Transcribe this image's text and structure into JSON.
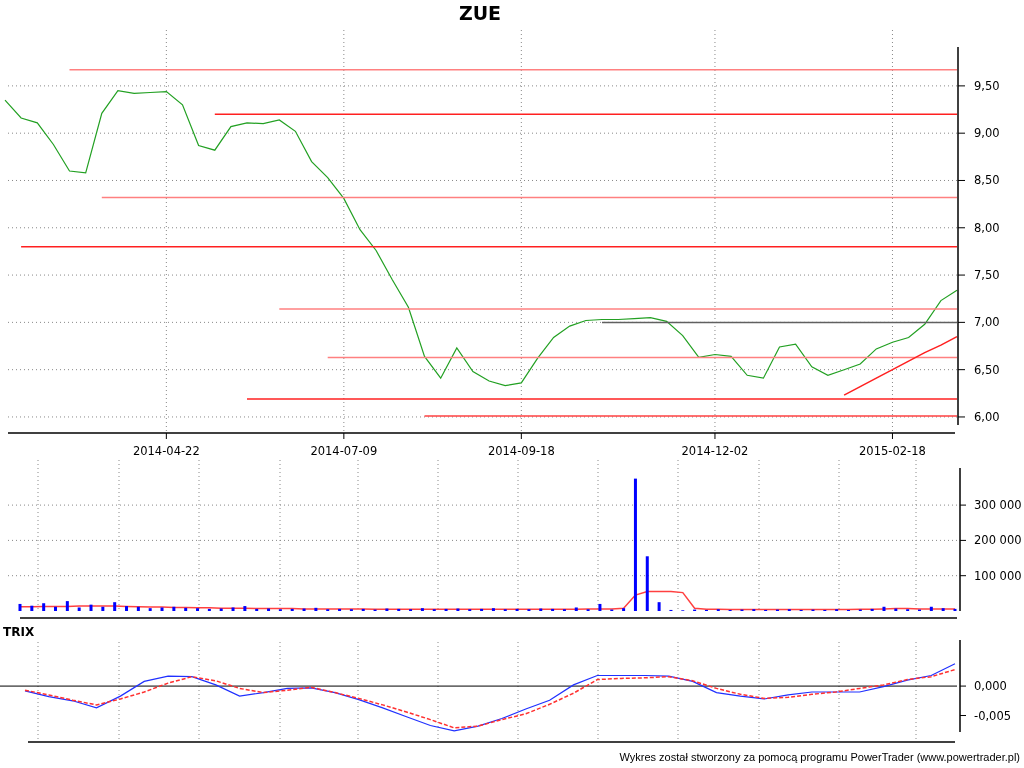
{
  "title": "ZUE",
  "price_panel": {
    "chart_data": {
      "type": "line",
      "grid": true,
      "ylim": [
        5.915,
        9.911
      ],
      "categories": [
        null,
        null,
        null,
        null,
        null,
        null,
        null,
        null,
        null,
        null,
        "2014-04-22",
        null,
        null,
        null,
        null,
        null,
        null,
        null,
        null,
        null,
        null,
        "2014-07-09",
        null,
        null,
        null,
        null,
        null,
        null,
        null,
        null,
        null,
        null,
        "2014-09-18",
        null,
        null,
        null,
        null,
        null,
        null,
        null,
        null,
        null,
        null,
        null,
        "2014-12-02",
        null,
        null,
        null,
        null,
        null,
        null,
        null,
        null,
        null,
        null,
        "2015-02-18",
        null,
        null,
        null,
        null
      ],
      "yticks": [
        {
          "value": 6,
          "label": "6,00"
        },
        {
          "value": 6.5,
          "label": "6,50"
        },
        {
          "value": 7,
          "label": "7,00"
        },
        {
          "value": 7.5,
          "label": "7,50"
        },
        {
          "value": 8,
          "label": "8,00"
        },
        {
          "value": 8.5,
          "label": "8,50"
        },
        {
          "value": 9,
          "label": "9,00"
        },
        {
          "value": 9.5,
          "label": "9,50"
        }
      ],
      "series": [
        {
          "color": "#22a022",
          "values": [
            9.35,
            9.16,
            9.11,
            8.88,
            8.6,
            8.58,
            9.21,
            9.45,
            9.42,
            9.43,
            9.44,
            9.3,
            8.87,
            8.82,
            9.07,
            9.11,
            9.1,
            9.14,
            9.02,
            8.7,
            8.53,
            8.31,
            7.98,
            7.76,
            7.45,
            7.16,
            6.64,
            6.41,
            6.73,
            6.48,
            6.38,
            6.33,
            6.36,
            6.62,
            6.84,
            6.96,
            7.02,
            7.03,
            7.03,
            7.04,
            7.05,
            7.01,
            6.86,
            6.63,
            6.66,
            6.64,
            6.44,
            6.41,
            6.74,
            6.77,
            6.53,
            6.44,
            6.5,
            6.56,
            6.72,
            6.79,
            6.84,
            6.98,
            7.23,
            7.34
          ]
        },
        {
          "color": "#ff8080",
          "values": [
            null,
            null,
            null,
            null,
            9.67,
            9.67,
            9.67,
            9.67,
            9.67,
            9.67,
            9.67,
            9.67,
            9.67,
            9.67,
            9.67,
            9.67,
            9.67,
            9.67,
            9.67,
            9.67,
            9.67,
            9.67,
            9.67,
            9.67,
            9.67,
            9.67,
            9.67,
            9.67,
            9.67,
            9.67,
            9.67,
            9.67,
            9.67,
            9.67,
            9.67,
            9.67,
            9.67,
            9.67,
            9.67,
            9.67,
            9.67,
            9.67,
            9.67,
            9.67,
            9.67,
            9.67,
            9.67,
            9.67,
            9.67,
            9.67,
            9.67,
            9.67,
            9.67,
            9.67,
            9.67,
            9.67,
            9.67,
            9.67,
            9.67,
            9.67
          ]
        },
        {
          "color": "#ff2020",
          "values": [
            null,
            null,
            null,
            null,
            null,
            null,
            null,
            null,
            null,
            null,
            null,
            null,
            null,
            9.2,
            9.2,
            9.2,
            9.2,
            9.2,
            9.2,
            9.2,
            9.2,
            9.2,
            9.2,
            9.2,
            9.2,
            9.2,
            9.2,
            9.2,
            9.2,
            9.2,
            9.2,
            9.2,
            9.2,
            9.2,
            9.2,
            9.2,
            9.2,
            9.2,
            9.2,
            9.2,
            9.2,
            9.2,
            9.2,
            9.2,
            9.2,
            9.2,
            9.2,
            9.2,
            9.2,
            9.2,
            9.2,
            9.2,
            9.2,
            9.2,
            9.2,
            9.2,
            9.2,
            9.2,
            9.2,
            9.2
          ]
        },
        {
          "color": "#ff8080",
          "values": [
            null,
            null,
            null,
            null,
            null,
            null,
            8.32,
            8.32,
            8.32,
            8.32,
            8.32,
            8.32,
            8.32,
            8.32,
            8.32,
            8.32,
            8.32,
            8.32,
            8.32,
            8.32,
            8.32,
            8.32,
            8.32,
            8.32,
            8.32,
            8.32,
            8.32,
            8.32,
            8.32,
            8.32,
            8.32,
            8.32,
            8.32,
            8.32,
            8.32,
            8.32,
            8.32,
            8.32,
            8.32,
            8.32,
            8.32,
            8.32,
            8.32,
            8.32,
            8.32,
            8.32,
            8.32,
            8.32,
            8.32,
            8.32,
            8.32,
            8.32,
            8.32,
            8.32,
            8.32,
            8.32,
            8.32,
            8.32,
            8.32,
            8.32
          ]
        },
        {
          "color": "#ff2020",
          "values": [
            null,
            7.8,
            7.8,
            7.8,
            7.8,
            7.8,
            7.8,
            7.8,
            7.8,
            7.8,
            7.8,
            7.8,
            7.8,
            7.8,
            7.8,
            7.8,
            7.8,
            7.8,
            7.8,
            7.8,
            7.8,
            7.8,
            7.8,
            7.8,
            7.8,
            7.8,
            7.8,
            7.8,
            7.8,
            7.8,
            7.8,
            7.8,
            7.8,
            7.8,
            7.8,
            7.8,
            7.8,
            7.8,
            7.8,
            7.8,
            7.8,
            7.8,
            7.8,
            7.8,
            7.8,
            7.8,
            7.8,
            7.8,
            7.8,
            7.8,
            7.8,
            7.8,
            7.8,
            7.8,
            7.8,
            7.8,
            7.8,
            7.8,
            7.8,
            7.8
          ]
        },
        {
          "color": "#ff8080",
          "values": [
            null,
            null,
            null,
            null,
            null,
            null,
            null,
            null,
            null,
            null,
            null,
            null,
            null,
            null,
            null,
            null,
            null,
            7.14,
            7.14,
            7.14,
            7.14,
            7.14,
            7.14,
            7.14,
            7.14,
            7.14,
            7.14,
            7.14,
            7.14,
            7.14,
            7.14,
            7.14,
            7.14,
            7.14,
            7.14,
            7.14,
            7.14,
            7.14,
            7.14,
            7.14,
            7.14,
            7.14,
            7.14,
            7.14,
            7.14,
            7.14,
            7.14,
            7.14,
            7.14,
            7.14,
            7.14,
            7.14,
            7.14,
            7.14,
            7.14,
            7.14,
            7.14,
            7.14,
            7.14,
            7.14
          ]
        },
        {
          "color": "#606060",
          "values": [
            null,
            null,
            null,
            null,
            null,
            null,
            null,
            null,
            null,
            null,
            null,
            null,
            null,
            null,
            null,
            null,
            null,
            null,
            null,
            null,
            null,
            null,
            null,
            null,
            null,
            null,
            null,
            null,
            null,
            null,
            null,
            null,
            null,
            null,
            null,
            null,
            null,
            7.0,
            7.0,
            7.0,
            7.0,
            7.0,
            7.0,
            7.0,
            7.0,
            7.0,
            7.0,
            7.0,
            7.0,
            7.0,
            7.0,
            7.0,
            7.0,
            7.0,
            7.0,
            7.0,
            7.0,
            7.0,
            7.0,
            7.0
          ]
        },
        {
          "color": "#ff8080",
          "values": [
            null,
            null,
            null,
            null,
            null,
            null,
            null,
            null,
            null,
            null,
            null,
            null,
            null,
            null,
            null,
            null,
            null,
            null,
            null,
            null,
            6.63,
            6.63,
            6.63,
            6.63,
            6.63,
            6.63,
            6.63,
            6.63,
            6.63,
            6.63,
            6.63,
            6.63,
            6.63,
            6.63,
            6.63,
            6.63,
            6.63,
            6.63,
            6.63,
            6.63,
            6.63,
            6.63,
            6.63,
            6.63,
            6.63,
            6.63,
            6.63,
            6.63,
            6.63,
            6.63,
            6.63,
            6.63,
            6.63,
            6.63,
            6.63,
            6.63,
            6.63,
            6.63,
            6.63,
            6.63
          ]
        },
        {
          "color": "#ff2020",
          "values": [
            null,
            null,
            null,
            null,
            null,
            null,
            null,
            null,
            null,
            null,
            null,
            null,
            null,
            null,
            null,
            6.19,
            6.19,
            6.19,
            6.19,
            6.19,
            6.19,
            6.19,
            6.19,
            6.19,
            6.19,
            6.19,
            6.19,
            6.19,
            6.19,
            6.19,
            6.19,
            6.19,
            6.19,
            6.19,
            6.19,
            6.19,
            6.19,
            6.19,
            6.19,
            6.19,
            6.19,
            6.19,
            6.19,
            6.19,
            6.19,
            6.19,
            6.19,
            6.19,
            6.19,
            6.19,
            6.19,
            6.19,
            6.19,
            6.19,
            6.19,
            6.19,
            6.19,
            6.19,
            6.19,
            6.19
          ]
        },
        {
          "color": "#ff4040",
          "values": [
            null,
            null,
            null,
            null,
            null,
            null,
            null,
            null,
            null,
            null,
            null,
            null,
            null,
            null,
            null,
            null,
            null,
            null,
            null,
            null,
            null,
            null,
            null,
            null,
            null,
            null,
            6.01,
            6.01,
            6.01,
            6.01,
            6.01,
            6.01,
            6.01,
            6.01,
            6.01,
            6.01,
            6.01,
            6.01,
            6.01,
            6.01,
            6.01,
            6.01,
            6.01,
            6.01,
            6.01,
            6.01,
            6.01,
            6.01,
            6.01,
            6.01,
            6.01,
            6.01,
            6.01,
            6.01,
            6.01,
            6.01,
            6.01,
            6.01,
            6.01,
            6.01
          ]
        },
        {
          "color": "#ff2020",
          "values": [
            null,
            null,
            null,
            null,
            null,
            null,
            null,
            null,
            null,
            null,
            null,
            null,
            null,
            null,
            null,
            null,
            null,
            null,
            null,
            null,
            null,
            null,
            null,
            null,
            null,
            null,
            null,
            null,
            null,
            null,
            null,
            null,
            null,
            null,
            null,
            null,
            null,
            null,
            null,
            null,
            null,
            null,
            null,
            null,
            null,
            null,
            null,
            null,
            null,
            null,
            null,
            null,
            6.23,
            6.32,
            6.41,
            6.5,
            6.59,
            6.68,
            6.76,
            6.85
          ]
        }
      ]
    }
  },
  "volume_panel": {
    "chart_data": {
      "type": "bar",
      "grid": true,
      "ylim": [
        0,
        405100
      ],
      "categories": [
        null,
        null,
        null,
        null,
        null,
        null,
        null,
        null,
        null,
        null,
        null,
        null,
        null,
        null,
        null,
        null,
        null,
        null,
        null,
        null,
        null,
        null,
        null,
        null,
        null,
        null,
        null,
        null,
        null,
        null,
        null,
        null,
        null,
        null,
        null,
        null,
        null,
        null,
        null,
        null,
        null,
        null,
        null,
        null,
        null,
        null,
        null,
        null,
        null,
        null,
        null,
        null,
        null,
        null,
        null,
        null,
        null,
        null,
        null,
        null,
        null,
        null,
        null,
        null,
        null,
        null,
        null,
        null,
        null,
        null,
        null,
        null,
        null,
        null,
        null,
        null,
        null,
        null,
        null,
        null
      ],
      "yticks": [
        {
          "value": 100000,
          "label": "100 000"
        },
        {
          "value": 200000,
          "label": "200 000"
        },
        {
          "value": 300000,
          "label": "300 000"
        }
      ],
      "series": [
        {
          "color": "#0000ff",
          "values": [
            20000,
            15000,
            22000,
            12000,
            28000,
            10000,
            18000,
            12000,
            25000,
            14000,
            12000,
            8000,
            10000,
            12000,
            9000,
            8000,
            6000,
            7000,
            10000,
            14000,
            6000,
            7000,
            5000,
            6000,
            7000,
            9000,
            5000,
            6000,
            5000,
            6000,
            4000,
            7000,
            6000,
            5000,
            8000,
            5000,
            6000,
            7000,
            5000,
            6000,
            8000,
            5000,
            6000,
            5000,
            7000,
            6000,
            5000,
            10000,
            5000,
            20000,
            4000,
            8000,
            375000,
            155000,
            25000,
            3000,
            2000,
            4000,
            3000,
            5000,
            3000,
            4000,
            5000,
            3000,
            4000,
            5000,
            3000,
            4000,
            3000,
            5000,
            3000,
            4000,
            6000,
            12000,
            7000,
            5000,
            4000,
            12000,
            8000,
            6000
          ]
        },
        {
          "type": "line",
          "color": "#ff4040",
          "values": [
            12000,
            12000,
            13000,
            13000,
            13000,
            14000,
            14000,
            14000,
            14000,
            13000,
            12000,
            11000,
            11000,
            10000,
            10000,
            9000,
            9000,
            8000,
            8000,
            8000,
            7000,
            7000,
            7000,
            7000,
            6000,
            6000,
            6000,
            6000,
            6000,
            6000,
            5000,
            5000,
            5000,
            5000,
            5000,
            5000,
            5000,
            5000,
            5000,
            5000,
            5000,
            5000,
            5000,
            5000,
            5000,
            5000,
            5000,
            5000,
            6000,
            6000,
            6000,
            8000,
            45000,
            55000,
            55000,
            55000,
            52000,
            8000,
            5000,
            5000,
            4000,
            4000,
            4000,
            4000,
            4000,
            4000,
            4000,
            4000,
            4000,
            4000,
            4000,
            5000,
            5000,
            6000,
            7000,
            7000,
            6000,
            6000,
            6000,
            6000
          ]
        }
      ]
    }
  },
  "trix_panel": {
    "label": "TRIX",
    "chart_data": {
      "type": "line",
      "grid": true,
      "ylim": [
        -0.0078,
        0.00783
      ],
      "categories": [
        null,
        null,
        null,
        null,
        null,
        null,
        null,
        null,
        null,
        null,
        null,
        null,
        null,
        null,
        null,
        null,
        null,
        null,
        null,
        null,
        null,
        null,
        null,
        null,
        null,
        null,
        null,
        null,
        null,
        null,
        null,
        null,
        null,
        null,
        null,
        null,
        null,
        null,
        null,
        null
      ],
      "yticks": [
        {
          "value": 0,
          "label": "0,000"
        },
        {
          "value": -0.005,
          "label": "-0,005"
        }
      ],
      "series": [
        {
          "color": "#2030ff",
          "line_style": "solid",
          "values": [
            -0.0008,
            -0.0018,
            -0.0025,
            -0.0037,
            -0.0017,
            0.0008,
            0.0017,
            0.0016,
            0.0002,
            -0.0017,
            -0.0011,
            -0.0004,
            -0.0003,
            -0.0011,
            -0.0023,
            -0.0037,
            -0.0052,
            -0.0067,
            -0.0076,
            -0.0068,
            -0.0055,
            -0.0039,
            -0.0024,
            0.0002,
            0.0018,
            0.0018,
            0.0018,
            0.0017,
            0.0008,
            -0.0011,
            -0.0017,
            -0.0022,
            -0.0015,
            -0.001,
            -0.001,
            -0.001,
            -0.0001,
            0.001,
            0.0018,
            0.0038
          ]
        },
        {
          "color": "#ff3030",
          "line_style": "dashed",
          "values": [
            -0.0007,
            -0.0015,
            -0.0024,
            -0.0032,
            -0.0022,
            -0.001,
            0.0005,
            0.0016,
            0.0009,
            -0.0004,
            -0.0011,
            -0.0007,
            -0.0002,
            -0.0011,
            -0.0021,
            -0.0032,
            -0.0044,
            -0.0057,
            -0.0071,
            -0.0068,
            -0.0057,
            -0.0047,
            -0.0031,
            -0.0012,
            0.0011,
            0.0013,
            0.0014,
            0.0016,
            0.0009,
            -0.0004,
            -0.0014,
            -0.0021,
            -0.0019,
            -0.0014,
            -0.001,
            -0.0004,
            0.0002,
            0.0011,
            0.0016,
            0.0028
          ]
        }
      ]
    }
  },
  "footer": "Wykres został stworzony za pomocą programu PowerTrader (www.powertrader.pl)"
}
